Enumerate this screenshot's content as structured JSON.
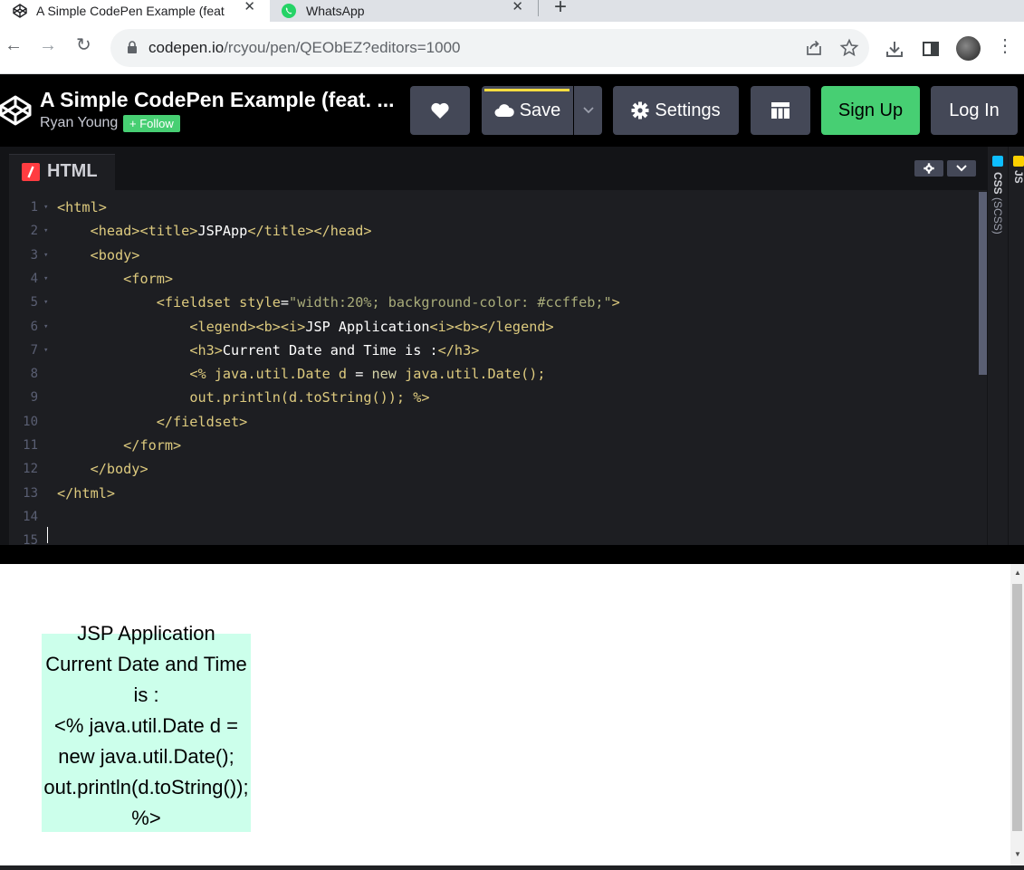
{
  "browser": {
    "tabs": [
      {
        "title": "A Simple CodePen Example (feat",
        "close": "✕",
        "active": true
      },
      {
        "title": "WhatsApp",
        "close": "✕",
        "active": false
      }
    ],
    "new_tab": "+",
    "nav": {
      "back": "←",
      "forward": "→",
      "reload": "↻"
    },
    "url": {
      "host": "codepen.io",
      "path": "/rcyou/pen/QEObEZ?editors=1000"
    },
    "menu": "⋮"
  },
  "header": {
    "pen_title": "A Simple CodePen Example (feat. ...",
    "author": "Ryan Young",
    "follow": "+ Follow",
    "save": "Save",
    "settings": "Settings",
    "sign_up": "Sign Up",
    "log_in": "Log In"
  },
  "editor": {
    "tab_label": "HTML",
    "side_css": "CSS",
    "side_css_sub": "(SCSS)",
    "side_js": "JS",
    "line_numbers": [
      "1",
      "2",
      "3",
      "4",
      "5",
      "6",
      "7",
      "8",
      "9",
      "10",
      "11",
      "12",
      "13",
      "14",
      "15"
    ],
    "lines": [
      {
        "indent": "",
        "parts": [
          {
            "c": "tag",
            "t": "<html>"
          }
        ],
        "fold": true
      },
      {
        "indent": "    ",
        "parts": [
          {
            "c": "tag",
            "t": "<head><title>"
          },
          {
            "c": "txt",
            "t": "JSPApp"
          },
          {
            "c": "tag",
            "t": "</title></head>"
          }
        ],
        "fold": true
      },
      {
        "indent": "    ",
        "parts": [
          {
            "c": "tag",
            "t": "<body>"
          }
        ],
        "fold": true
      },
      {
        "indent": "        ",
        "parts": [
          {
            "c": "tag",
            "t": "<form>"
          }
        ],
        "fold": true
      },
      {
        "indent": "            ",
        "parts": [
          {
            "c": "tag",
            "t": "<fieldset "
          },
          {
            "c": "attr",
            "t": "style"
          },
          {
            "c": "txt",
            "t": "="
          },
          {
            "c": "str",
            "t": "\"width:20%; background-color: #ccffeb;\""
          },
          {
            "c": "tag",
            "t": ">"
          }
        ],
        "fold": true
      },
      {
        "indent": "                ",
        "parts": [
          {
            "c": "tag",
            "t": "<legend><b><i>"
          },
          {
            "c": "txt",
            "t": "JSP Application"
          },
          {
            "c": "tag",
            "t": "<i><b></legend>"
          }
        ],
        "fold": true
      },
      {
        "indent": "                ",
        "parts": [
          {
            "c": "tag",
            "t": "<h3>"
          },
          {
            "c": "txt",
            "t": "Current Date and Time is :"
          },
          {
            "c": "tag",
            "t": "</h3>"
          }
        ],
        "fold": true
      },
      {
        "indent": "                ",
        "parts": [
          {
            "c": "tag",
            "t": "<% java.util.Date d "
          },
          {
            "c": "txt",
            "t": "= "
          },
          {
            "c": "kw",
            "t": "new"
          },
          {
            "c": "tag",
            "t": " java.util.Date();"
          }
        ],
        "fold": false
      },
      {
        "indent": "                ",
        "parts": [
          {
            "c": "tag",
            "t": "out.println(d.toString()); %>"
          }
        ],
        "fold": false
      },
      {
        "indent": "            ",
        "parts": [
          {
            "c": "tag",
            "t": "</fieldset>"
          }
        ],
        "fold": false
      },
      {
        "indent": "        ",
        "parts": [
          {
            "c": "tag",
            "t": "</form>"
          }
        ],
        "fold": false
      },
      {
        "indent": "    ",
        "parts": [
          {
            "c": "tag",
            "t": "</body>"
          }
        ],
        "fold": false
      },
      {
        "indent": "",
        "parts": [
          {
            "c": "tag",
            "t": "</html>"
          }
        ],
        "fold": false
      },
      {
        "indent": "",
        "parts": [],
        "fold": false
      },
      {
        "indent": "",
        "parts": [],
        "fold": false
      }
    ]
  },
  "preview": {
    "legend": "JSP Application",
    "lines": [
      "Current Date and Time",
      "is :",
      "<% java.util.Date d =",
      "new java.util.Date();",
      "out.println(d.toString());",
      "%>"
    ],
    "fieldset_bg": "#ccffeb"
  },
  "colors": {
    "green": "#47cf73",
    "red_badge": "#ff3c41",
    "yellow": "#ffdd40"
  }
}
